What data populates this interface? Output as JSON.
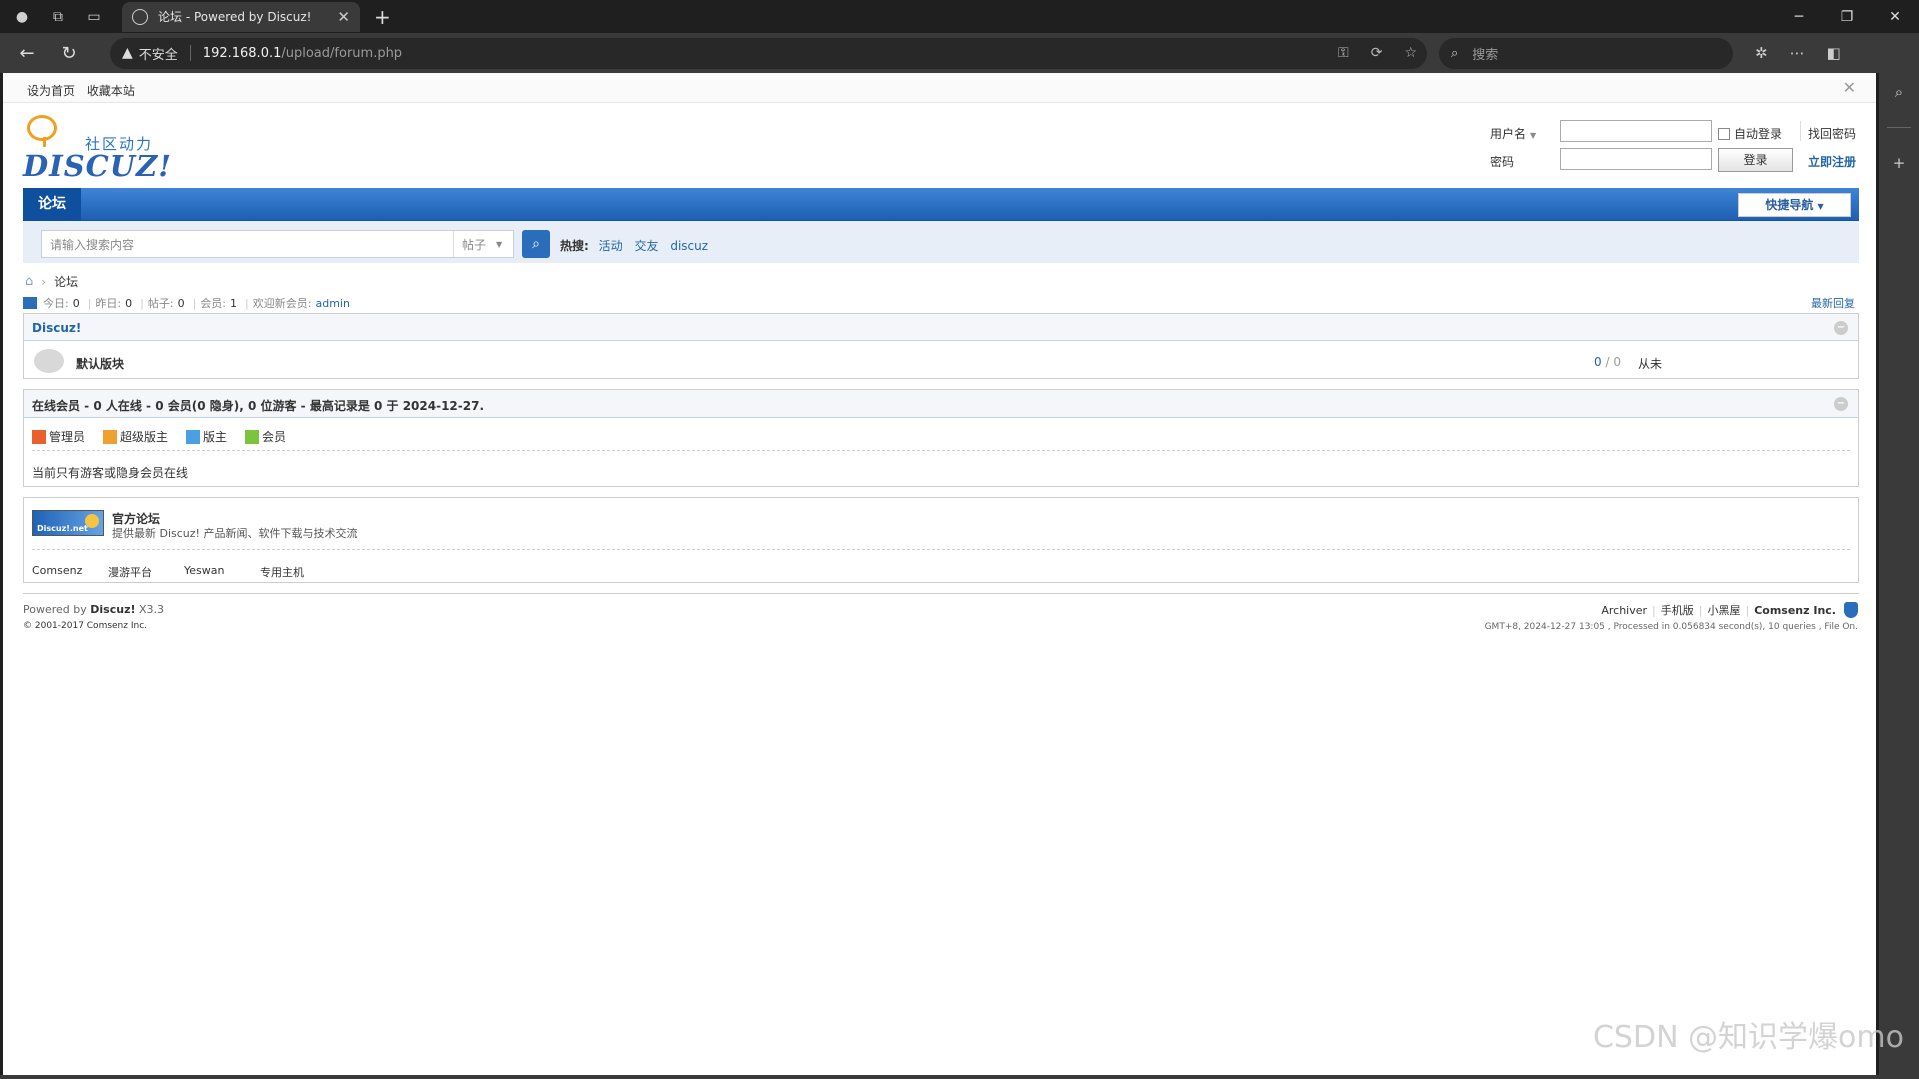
{
  "browser": {
    "tab_title": "论坛 - Powered by Discuz!",
    "insecure_label": "不安全",
    "url_host": "192.168.0.1",
    "url_path": "/upload/forum.php",
    "search_placeholder": "搜索"
  },
  "topbar": {
    "set_home": "设为首页",
    "bookmark": "收藏本站"
  },
  "logo": {
    "slogan": "社区动力",
    "wordmark": "DISCUZ!"
  },
  "login": {
    "username_label": "用户名",
    "password_label": "密码",
    "auto_login": "自动登录",
    "forgot": "找回密码",
    "login_btn": "登录",
    "register": "立即注册"
  },
  "nav": {
    "forum": "论坛",
    "quick_nav": "快捷导航"
  },
  "search": {
    "placeholder": "请输入搜索内容",
    "type": "帖子",
    "hot_label": "热搜:",
    "hot": [
      "活动",
      "交友",
      "discuz"
    ]
  },
  "breadcrumb": {
    "current": "论坛"
  },
  "stats": {
    "today_label": "今日:",
    "today": "0",
    "yesterday_label": "昨日:",
    "yesterday": "0",
    "posts_label": "帖子:",
    "posts": "0",
    "members_label": "会员:",
    "members": "1",
    "welcome_label": "欢迎新会员:",
    "newest": "admin",
    "latest_reply": "最新回复"
  },
  "category": {
    "name": "Discuz!",
    "forum_name": "默认版块",
    "threads": "0",
    "posts_sep": " / ",
    "posts": "0",
    "last": "从未"
  },
  "online": {
    "header": "在线会员 - 0 人在线 - 0 会员(0 隐身), 0 位游客 - 最高记录是 0 于 2024-12-27.",
    "legend": [
      {
        "label": "管理员",
        "color": "#e8602c"
      },
      {
        "label": "超级版主",
        "color": "#f0a030"
      },
      {
        "label": "版主",
        "color": "#4aa0e0"
      },
      {
        "label": "会员",
        "color": "#7cc440"
      }
    ],
    "message": "当前只有游客或隐身会员在线"
  },
  "friendlinks": {
    "banner_text": "Discuz!.net",
    "title": "官方论坛",
    "desc": "提供最新 Discuz! 产品新闻、软件下载与技术交流",
    "text_links": [
      "Comsenz",
      "漫游平台",
      "Yeswan",
      "专用主机"
    ]
  },
  "footer": {
    "powered_prefix": "Powered by ",
    "powered_brand": "Discuz!",
    "version": " X3.3",
    "copyright": "© 2001-2017 Comsenz Inc.",
    "links": [
      "Archiver",
      "手机版",
      "小黑屋"
    ],
    "company": "Comsenz Inc.",
    "time_info": "GMT+8, 2024-12-27 13:05 , Processed in 0.056834 second(s), 10 queries , File On."
  },
  "watermark": "CSDN @知识学爆omo"
}
